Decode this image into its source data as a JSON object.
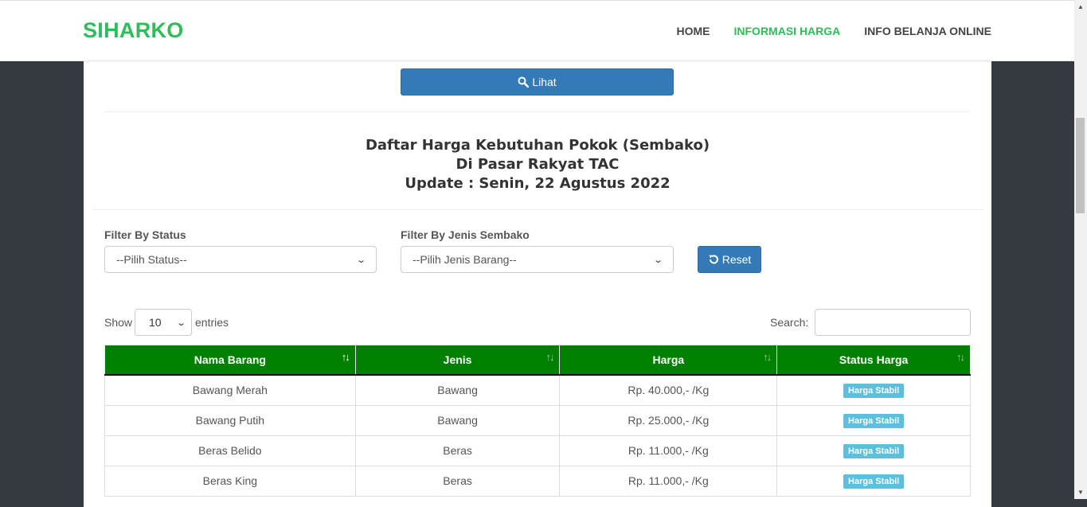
{
  "navbar": {
    "brand": "SIHARKO",
    "links": [
      {
        "label": "HOME",
        "active": false
      },
      {
        "label": "INFORMASI HARGA",
        "active": true
      },
      {
        "label": "INFO BELANJA ONLINE",
        "active": false
      }
    ]
  },
  "lihat_button": {
    "label": "Lihat",
    "icon": "search-icon"
  },
  "heading": {
    "line1": "Daftar Harga Kebutuhan Pokok (Sembako)",
    "line2": "Di Pasar Rakyat TAC",
    "line3": "Update : Senin, 22 Agustus 2022"
  },
  "filters": {
    "status_label": "Filter By Status",
    "status_value": "--Pilih Status--",
    "jenis_label": "Filter By Jenis Sembako",
    "jenis_value": "--Pilih Jenis Barang--",
    "reset_label": "Reset"
  },
  "datatable": {
    "show_label": "Show",
    "length_value": "10",
    "entries_label": "entries",
    "search_label": "Search:",
    "columns": [
      "Nama Barang",
      "Jenis",
      "Harga",
      "Status Harga"
    ],
    "rows": [
      {
        "nama": "Bawang Merah",
        "jenis": "Bawang",
        "harga": "Rp. 40.000,- /Kg",
        "status": "Harga Stabil"
      },
      {
        "nama": "Bawang Putih",
        "jenis": "Bawang",
        "harga": "Rp. 25.000,- /Kg",
        "status": "Harga Stabil"
      },
      {
        "nama": "Beras Belido",
        "jenis": "Beras",
        "harga": "Rp. 11.000,- /Kg",
        "status": "Harga Stabil"
      },
      {
        "nama": "Beras King",
        "jenis": "Beras",
        "harga": "Rp. 11.000,- /Kg",
        "status": "Harga Stabil"
      }
    ]
  },
  "colors": {
    "brand_green": "#2ebd59",
    "header_green": "#008000",
    "primary_blue": "#337ab7",
    "badge_blue": "#5bc0de",
    "page_background": "#343a40"
  }
}
